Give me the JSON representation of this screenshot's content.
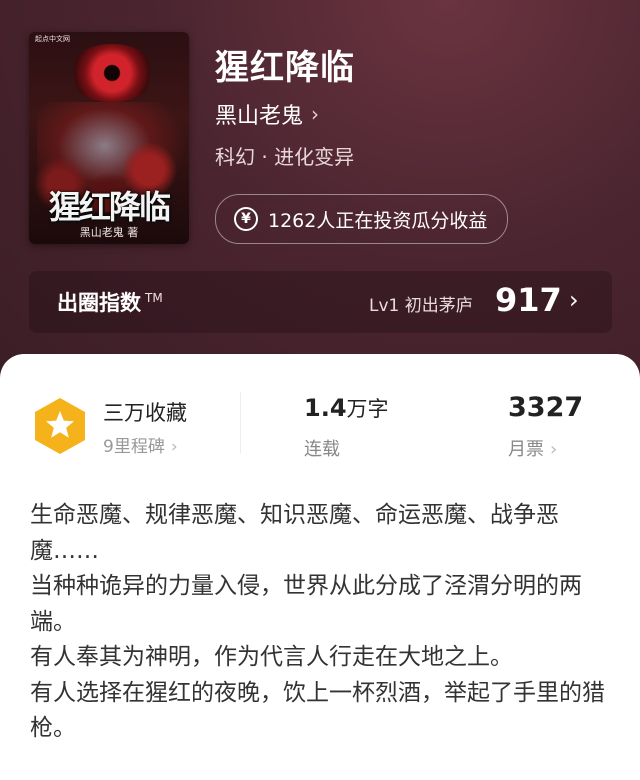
{
  "book": {
    "title": "猩红降临",
    "author": "黑山老鬼",
    "genre": "科幻 · 进化变异",
    "cover": {
      "publisher": "起点中文网",
      "title": "猩红降临",
      "author": "黑山老鬼 著"
    }
  },
  "invest": {
    "icon": "yen-icon",
    "text": "1262人正在投资瓜分收益"
  },
  "popularity": {
    "label": "出圈指数",
    "tm": "TM",
    "level": "Lv1 初出茅庐",
    "score": "917"
  },
  "stats": {
    "favorites": {
      "title": "三万收藏",
      "sub": "9里程碑"
    },
    "words": {
      "value": "1.4",
      "unit": "万字",
      "sub": "连载"
    },
    "tickets": {
      "value": "3327",
      "sub": "月票"
    }
  },
  "synopsis": [
    "生命恶魔、规律恶魔、知识恶魔、命运恶魔、战争恶魔……",
    "当种种诡异的力量入侵，世界从此分成了泾渭分明的两端。",
    "有人奉其为神明，作为代言人行走在大地之上。",
    "有人选择在猩红的夜晚，饮上一杯烈酒，举起了手里的猎枪。"
  ],
  "colors": {
    "hero_bg": "#4b2530",
    "badge": "#f5b21a",
    "text_dark": "#222222",
    "text_muted": "#999999"
  }
}
